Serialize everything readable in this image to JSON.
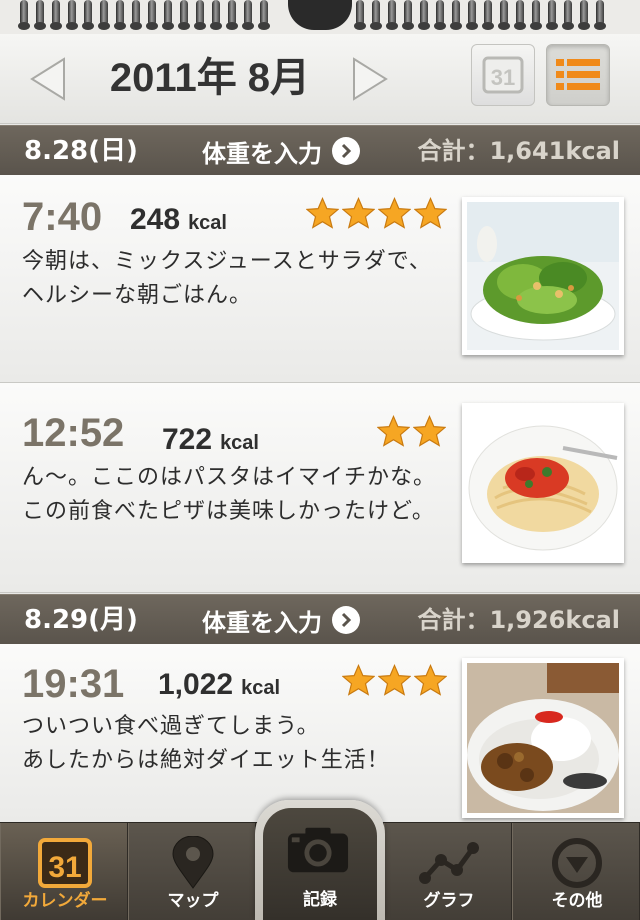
{
  "header": {
    "month_title": "2011年 8月",
    "prev_icon": "chevron-left-icon",
    "next_icon": "chevron-right-icon",
    "calendar_view_icon": "calendar-icon",
    "list_view_icon": "list-icon"
  },
  "days": [
    {
      "date": "8.28(日)",
      "weight_label": "体重を入力",
      "total": "合計：1,641kcal",
      "entries": [
        {
          "time": "7:40",
          "kcal": "248",
          "unit": "kcal",
          "stars": 4,
          "text": "今朝は、ミックスジュースとサラダで、ヘルシーな朝ごはん。",
          "photo": "salad-photo"
        },
        {
          "time": "12:52",
          "kcal": "722",
          "unit": "kcal",
          "stars": 2,
          "text": "ん〜。ここのはパスタはイマイチかな。この前食べたピザは美味しかったけど。",
          "photo": "pasta-photo"
        }
      ]
    },
    {
      "date": "8.29(月)",
      "weight_label": "体重を入力",
      "total": "合計：1,926kcal",
      "entries": [
        {
          "time": "19:31",
          "kcal": "1,022",
          "unit": "kcal",
          "stars": 3,
          "text_line1": "ついつい食べ過ぎてしまう。",
          "text_line2": "あしたからは絶対ダイエット生活！",
          "photo": "curry-photo"
        }
      ]
    }
  ],
  "tabs": {
    "calendar": "カレンダー",
    "map": "マップ",
    "record": "記録",
    "graph": "グラフ",
    "other": "その他"
  },
  "colors": {
    "accent": "#f2a93a",
    "day_bar": "#5f584f",
    "star": "#f6a623"
  }
}
